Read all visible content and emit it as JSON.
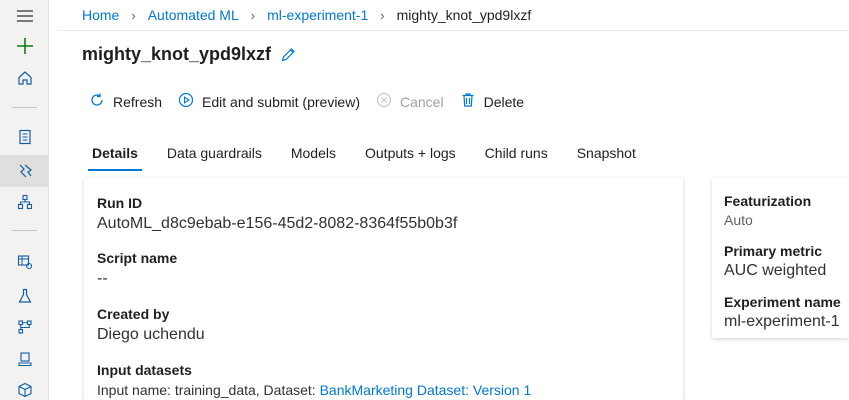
{
  "breadcrumb": {
    "items": [
      "Home",
      "Automated ML",
      "ml-experiment-1"
    ],
    "current": "mighty_knot_ypd9lxzf"
  },
  "title": "mighty_knot_ypd9lxzf",
  "toolbar": {
    "refresh": "Refresh",
    "edit_submit": "Edit and submit (preview)",
    "cancel": "Cancel",
    "delete": "Delete"
  },
  "tabs": [
    "Details",
    "Data guardrails",
    "Models",
    "Outputs + logs",
    "Child runs",
    "Snapshot"
  ],
  "details": {
    "run_id_label": "Run ID",
    "run_id": "AutoML_d8c9ebab-e156-45d2-8082-8364f55b0b3f",
    "script_label": "Script name",
    "script": "--",
    "created_label": "Created by",
    "created": "Diego uchendu",
    "datasets_label": "Input datasets",
    "datasets_prefix": "Input name: training_data, Dataset: ",
    "datasets_link": "BankMarketing Dataset: Version 1"
  },
  "side": {
    "featurization_label": "Featurization",
    "featurization": "Auto",
    "metric_label": "Primary metric",
    "metric": "AUC weighted",
    "experiment_label": "Experiment name",
    "experiment": "ml-experiment-1"
  },
  "colors": {
    "accent": "#0078d4",
    "plus": "#107c10",
    "rail": "#f3f2f1"
  },
  "rail_icons": [
    "hamburger-icon",
    "plus-icon",
    "home-icon",
    "notebook-icon",
    "automl-icon",
    "designer-icon",
    "datasets-icon",
    "experiments-icon",
    "pipelines-icon",
    "models-icon",
    "endpoints-icon"
  ]
}
